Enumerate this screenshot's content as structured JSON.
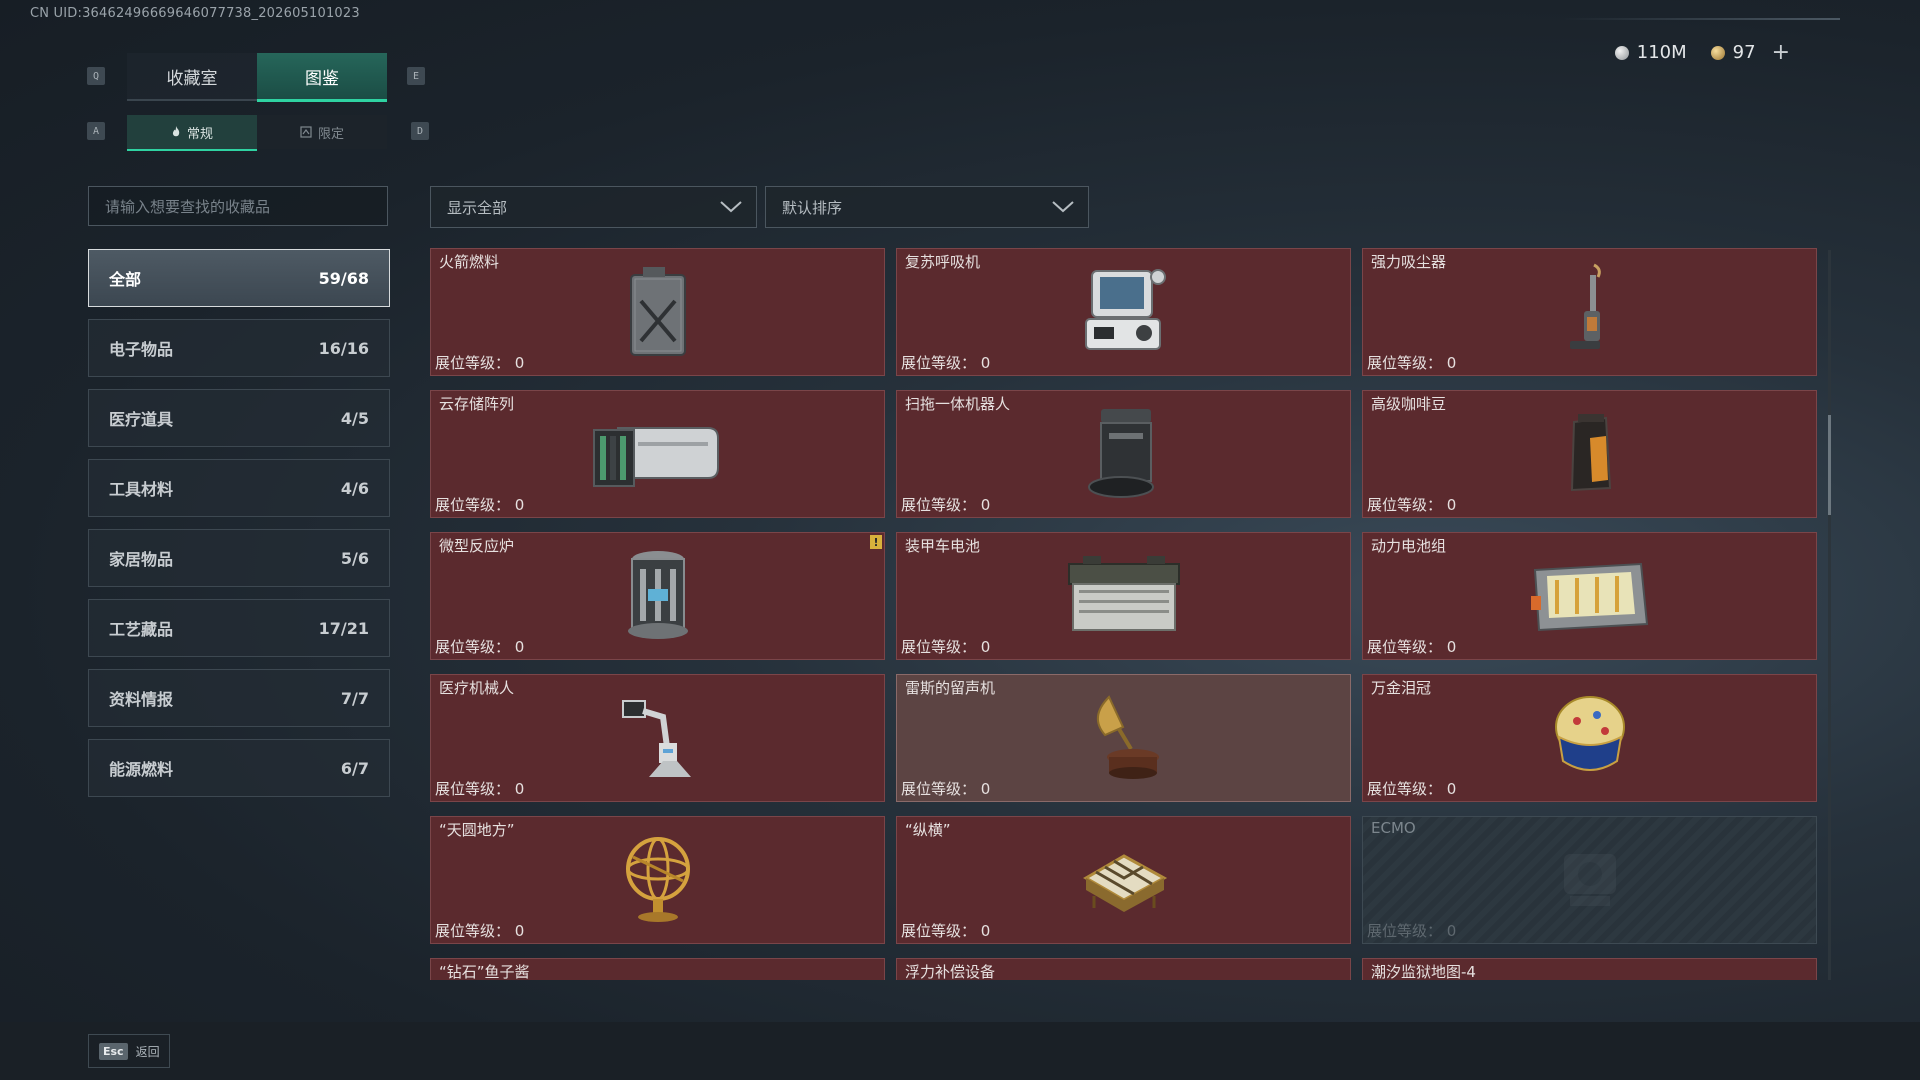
{
  "uid": "CN UID:36462496669646077738_202605101023",
  "currency": {
    "silver": "110M",
    "gold": "97",
    "plus": "+"
  },
  "keys": {
    "prev_tab": "Q",
    "next_tab": "E",
    "prev_sub": "A",
    "next_sub": "D"
  },
  "main_tabs": [
    {
      "label": "收藏室"
    },
    {
      "label": "图鉴"
    }
  ],
  "sub_tabs": [
    {
      "label": "常规"
    },
    {
      "label": "限定"
    }
  ],
  "search": {
    "placeholder": "请输入想要查找的收藏品"
  },
  "filter": {
    "value": "显示全部"
  },
  "sort": {
    "value": "默认排序"
  },
  "categories": [
    {
      "label": "全部",
      "count": "59/68"
    },
    {
      "label": "电子物品",
      "count": "16/16"
    },
    {
      "label": "医疗道具",
      "count": "4/5"
    },
    {
      "label": "工具材料",
      "count": "4/6"
    },
    {
      "label": "家居物品",
      "count": "5/6"
    },
    {
      "label": "工艺藏品",
      "count": "17/21"
    },
    {
      "label": "资料情报",
      "count": "7/7"
    },
    {
      "label": "能源燃料",
      "count": "6/7"
    }
  ],
  "level_label": "展位等级：",
  "items": [
    {
      "name": "火箭燃料",
      "level": "0",
      "icon": "fuel-canister"
    },
    {
      "name": "复苏呼吸机",
      "level": "0",
      "icon": "ventilator"
    },
    {
      "name": "强力吸尘器",
      "level": "0",
      "icon": "vacuum-cleaner"
    },
    {
      "name": "云存储阵列",
      "level": "0",
      "icon": "storage-array"
    },
    {
      "name": "扫拖一体机器人",
      "level": "0",
      "icon": "mop-robot"
    },
    {
      "name": "高级咖啡豆",
      "level": "0",
      "icon": "coffee-bag"
    },
    {
      "name": "微型反应炉",
      "level": "0",
      "icon": "reactor"
    },
    {
      "name": "装甲车电池",
      "level": "0",
      "icon": "vehicle-battery"
    },
    {
      "name": "动力电池组",
      "level": "0",
      "icon": "battery-pack"
    },
    {
      "name": "医疗机械人",
      "level": "0",
      "icon": "medical-robot"
    },
    {
      "name": "雷斯的留声机",
      "level": "0",
      "icon": "gramophone"
    },
    {
      "name": "万金泪冠",
      "level": "0",
      "icon": "jeweled-egg"
    },
    {
      "name": "“天圆地方”",
      "level": "0",
      "icon": "armillary-sphere"
    },
    {
      "name": "“纵横”",
      "level": "0",
      "icon": "chessboard"
    },
    {
      "name": "ECMO",
      "level": "0",
      "icon": "ecmo-machine"
    },
    {
      "name": "“钻石”鱼子酱",
      "level": "",
      "icon": "caviar"
    },
    {
      "name": "浮力补偿设备",
      "level": "",
      "icon": "buoyancy-device"
    },
    {
      "name": "潮汐监狱地图-4",
      "level": "",
      "icon": "map"
    }
  ],
  "esc": {
    "key": "Esc",
    "label": "返回"
  },
  "colors": {
    "accent": "#2fd3a2",
    "card_bg": "#5b2a2e",
    "card_locked": "#29333b"
  }
}
